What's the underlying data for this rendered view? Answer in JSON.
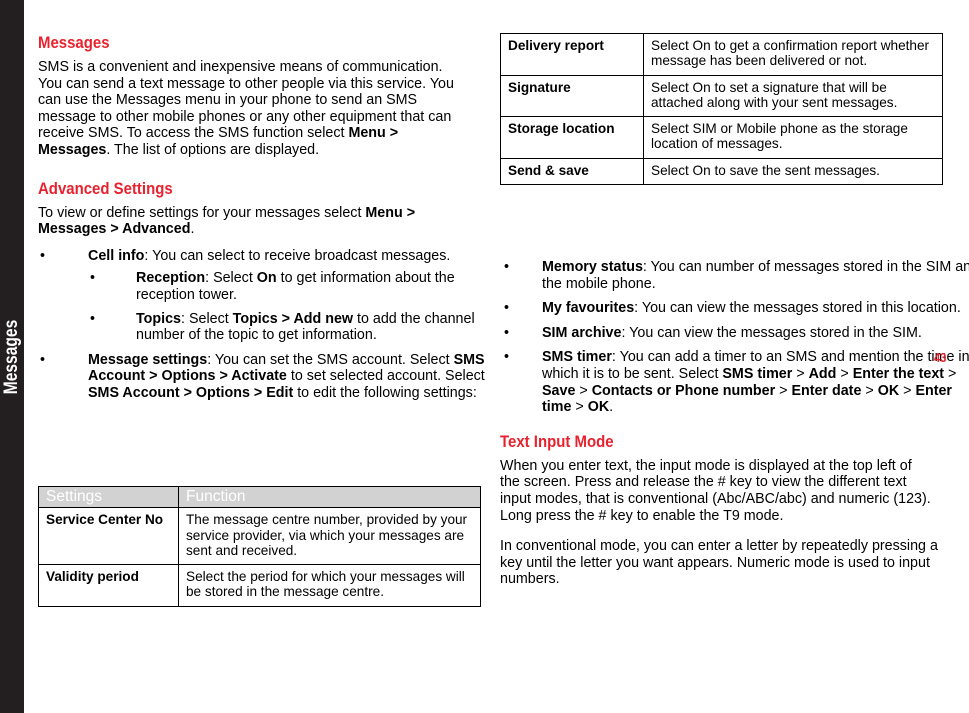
{
  "sidebar": {
    "tab_label": "Messages"
  },
  "page_number": "43",
  "colors": {
    "heading_red": "#e8222e",
    "tab_bar": "#231f20",
    "table_header_bg": "#d2d2d2",
    "table_header_text": "#ffffff"
  },
  "left_column": {
    "heading_messages": "Messages",
    "intro_paragraph_plain": "SMS is a convenient and inexpensive means of communication. You can send a text message to other people via this service. You can use the Messages menu in your phone to send an SMS message to other mobile phones or any other equipment that can receive SMS. To access the SMS function select Menu > Messages. The list of options are displayed.",
    "intro_parts": {
      "p1": "SMS is a convenient and inexpensive means of communication. You can send a text message to other people via this service. You can use the Messages menu in your phone to send an SMS message to other mobile phones or any other equipment that can receive SMS. To access the SMS function select ",
      "p2_bold": "Menu > Messages",
      "p3": ". The list of options are displayed."
    },
    "heading_advanced": "Advanced Settings",
    "advanced_intro": {
      "p1": "To view or define settings for your messages select ",
      "p2_bold": "Menu > Messages > Advanced",
      "p3": "."
    },
    "bullets": [
      {
        "bullet": "•",
        "term": "Cell info",
        "text_after_term": ": You can select to receive broadcast messages.",
        "sub_bullets": [
          {
            "bullet": "•",
            "term": "Reception",
            "seg1": ": Select ",
            "bold1": "On",
            "seg2": " to get information about the reception tower."
          },
          {
            "bullet": "•",
            "term": "Topics",
            "seg1": ":  Select ",
            "bold1": "Topics > Add new",
            "seg2": " to add the channel number of the topic to get information."
          }
        ]
      },
      {
        "bullet": "•",
        "term": "Message settings",
        "seg1": ": You can set the SMS account. Select ",
        "bold1": "SMS Account > Options > Activate",
        "seg2": " to set selected account. Select ",
        "bold2": "SMS Account > Options > Edit",
        "seg3": " to edit the following settings:"
      }
    ],
    "settings_table": {
      "headers": [
        "Settings",
        "Function"
      ],
      "rows": [
        {
          "setting": "Service Center No",
          "function": "The message centre number, provided by your service provider, via which your messages are sent and received."
        },
        {
          "setting": "Validity period",
          "function": "Select the period for which your messages will be stored in the message centre."
        }
      ]
    }
  },
  "right_column": {
    "advanced_table": {
      "rows": [
        {
          "setting": "Delivery report",
          "function": "Select On to get a confirmation report whether message has been delivered or not."
        },
        {
          "setting": "Signature",
          "function": "Select On to set a signature that will be attached along with your sent messages."
        },
        {
          "setting": "Storage location",
          "function": "Select SIM or Mobile phone as the storage location of messages."
        },
        {
          "setting": "Send & save",
          "function": "Select On to save the sent messages."
        }
      ]
    },
    "bullets": [
      {
        "bullet": "•",
        "term": "Memory status",
        "text_after_term": ": You can number of messages stored in the SIM and the mobile phone."
      },
      {
        "bullet": "•",
        "term": "My favourites",
        "text_after_term": ": You can view the messages stored in this location."
      },
      {
        "bullet": "•",
        "term": "SIM archive",
        "text_after_term": ": You can view the messages stored in the SIM."
      },
      {
        "bullet": "•",
        "term": "SMS timer",
        "seg1": ": You can add a timer to an SMS and mention the time in which it is to be sent. Select ",
        "bold1": "SMS timer",
        "sep1": " > ",
        "bold2": "Add",
        "sep2": " > ",
        "bold3": "Enter the text",
        "sep3": " > ",
        "bold4": "Save",
        "sep4": " > ",
        "bold5": "Contacts or Phone number",
        "sep5": " > ",
        "bold6": "Enter date",
        "sep6": " > ",
        "bold7": "OK",
        "sep7": " > ",
        "bold8": "Enter time",
        "sep8": " > ",
        "bold9": "OK",
        "tail": "."
      }
    ],
    "heading_text_input": "Text Input Mode",
    "text_input_paragraph_1": "When you enter text, the input mode is displayed at the top left of the screen. Press and release the # key to view the different text input modes, that is conventional (Abc/ABC/abc) and numeric (123). Long press the # key to enable the T9 mode.",
    "text_input_paragraph_2": "In conventional mode, you can enter a letter by repeatedly pressing a key until the letter you want appears. Numeric mode is used to input numbers."
  }
}
